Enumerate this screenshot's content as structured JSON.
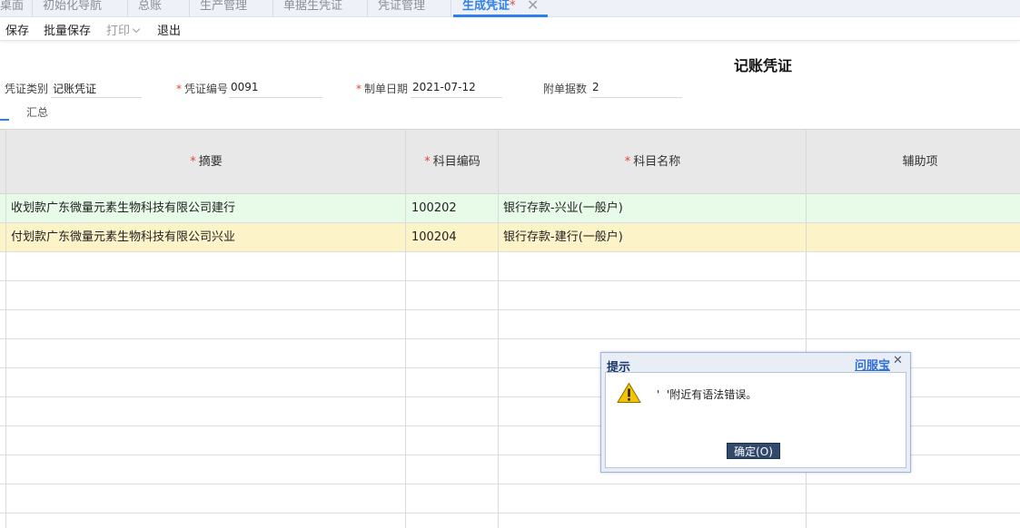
{
  "tabs": [
    {
      "label": "桌面"
    },
    {
      "label": "初始化导航"
    },
    {
      "label": "总账"
    },
    {
      "label": "生产管理"
    },
    {
      "label": "单据生凭证"
    },
    {
      "label": "凭证管理"
    },
    {
      "label": "生成凭证",
      "active": true,
      "modified_mark": "*"
    }
  ],
  "toolbar": {
    "save": "保存",
    "batch_save": "批量保存",
    "print": "打印",
    "exit": "退出"
  },
  "voucher": {
    "title": "记账凭证",
    "type_label": "凭证类别",
    "type_value": "记账凭证",
    "number_label": "凭证编号",
    "number_value": "0091",
    "date_label": "制单日期",
    "date_value": "2021-07-12",
    "attachments_label": "附单据数",
    "attachments_value": "2",
    "required_mark": "*"
  },
  "subtabs": {
    "summary": "汇总"
  },
  "grid": {
    "columns": {
      "summary": "摘要",
      "account_code": "科目编码",
      "account_name": "科目名称",
      "auxiliary": "辅助项"
    },
    "rows": [
      {
        "summary": "收划款广东微量元素生物科技有限公司建行",
        "account_code": "100202",
        "account_name": "银行存款-兴业(一般户)",
        "auxiliary": ""
      },
      {
        "summary": "付划款广东微量元素生物科技有限公司兴业",
        "account_code": "100204",
        "account_name": "银行存款-建行(一般户)",
        "auxiliary": ""
      }
    ]
  },
  "dialog": {
    "title": "提示",
    "help_link": "问服宝",
    "message": "'  '附近有语法错误。",
    "ok_button": "确定(O)"
  },
  "colors": {
    "accent": "#2f80ed",
    "required": "#e0473c",
    "row_green": "#e8fbe8",
    "row_yellow": "#fdf3c8",
    "ok_button": "#31496d"
  }
}
